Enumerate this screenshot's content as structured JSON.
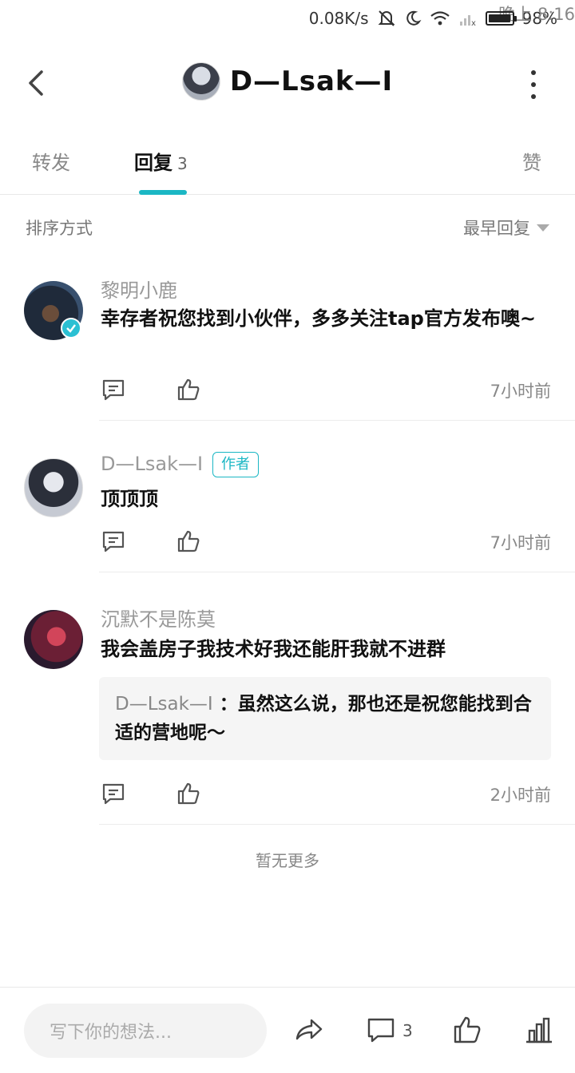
{
  "status_bar": {
    "time": "晚上 8:16",
    "net_speed": "0.08K/s",
    "battery": "98%",
    "battery_level": 0.98
  },
  "header": {
    "title": "D—Lsak—I"
  },
  "tabs": [
    {
      "label": "转发",
      "count": ""
    },
    {
      "label": "回复",
      "count": "3"
    },
    {
      "label": "赞",
      "count": ""
    }
  ],
  "sort": {
    "label": "排序方式",
    "value": "最早回复"
  },
  "comments": [
    {
      "name": "黎明小鹿",
      "text": "幸存者祝您找到小伙伴，多多关注tap官方发布噢~",
      "time": "7小时前",
      "verified": true
    },
    {
      "name": "D—Lsak—I",
      "badge": "作者",
      "text": "顶顶顶",
      "time": "7小时前"
    },
    {
      "name": "沉默不是陈莫",
      "text": "我会盖房子我技术好我还能肝我就不进群",
      "reply": {
        "name": "D—Lsak—I",
        "separator": " ：",
        "text": "虽然这么说，那也还是祝您能找到合适的营地呢～"
      },
      "time": "2小时前"
    }
  ],
  "no_more": "暂无更多",
  "bottom": {
    "input_placeholder": "写下你的想法...",
    "comment_count": "3"
  },
  "colors": {
    "accent": "#1bb7c4"
  }
}
